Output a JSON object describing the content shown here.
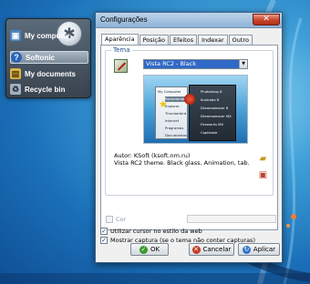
{
  "colors": {
    "desktop": "#1a6fb8",
    "selection": "#3169c6",
    "close_button": "#c8452c",
    "group_label": "#1f4f8a"
  },
  "launcher": {
    "items": [
      {
        "label": "My computer",
        "icon": "computer-icon",
        "selected": false
      },
      {
        "label": "Softonic",
        "icon": "help-icon",
        "selected": true
      },
      {
        "label": "My documents",
        "icon": "folder-icon",
        "selected": false
      },
      {
        "label": "Recycle bin",
        "icon": "recycle-bin-icon",
        "selected": false
      }
    ]
  },
  "dialog": {
    "title": "Configurações",
    "tabs": [
      "Aparência",
      "Posição",
      "Efeitos",
      "Indexar",
      "Outro"
    ],
    "active_tab": "Aparência",
    "theme_group": {
      "label": "Tema",
      "selected_theme": "Vista RC2 - Black",
      "author_line": "Autor:        KSoft (ksoft.nm.ru)",
      "description": "Vista RC2 theme. Black glass. Animation, tab.",
      "preview": {
        "left_items": [
          "My Computer",
          "Recomendado",
          "Explorar",
          "Thunderbird",
          "Internet",
          "Programas",
          "Documentos"
        ],
        "right_items": [
          "Photoshop 8",
          "Ilustrado 8",
          "Dreamweaver 8",
          "Dreamweaver MX",
          "Fireworks MX",
          "Captivate"
        ]
      }
    },
    "cor_label": "Cor",
    "options": [
      {
        "label": "Utilizar cursor no estilo da web",
        "checked": true
      },
      {
        "label": "Mostrar captura (se o tema não conter capturas)",
        "checked": true
      }
    ],
    "buttons": {
      "ok": "OK",
      "cancel": "Cancelar",
      "apply": "Aplicar"
    }
  }
}
